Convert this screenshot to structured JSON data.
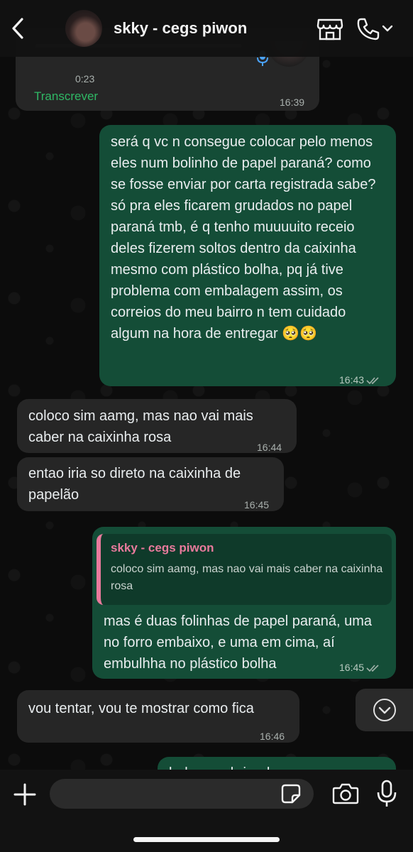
{
  "header": {
    "contact_name": "skky - cegs piwon"
  },
  "voice_message": {
    "duration": "0:23",
    "transcribe_label": "Transcrever",
    "time": "16:39"
  },
  "messages": [
    {
      "direction": "out",
      "text": "será q vc n consegue colocar pelo menos eles num bolinho de papel paraná? como se fosse enviar por carta registrada sabe? só pra eles ficarem grudados no papel paraná tmb, é q tenho muuuuito receio deles fizerem soltos dentro da caixinha mesmo com plástico bolha, pq já tive problema com embalagem assim, os correios do meu bairro n tem cuidado algum na hora de entregar 🥺🥺",
      "time": "16:43"
    },
    {
      "direction": "in",
      "text": "coloco sim aamg, mas nao vai mais caber na caixinha rosa",
      "time": "16:44"
    },
    {
      "direction": "in",
      "text": "entao iria so direto na caixinha de papelão",
      "time": "16:45"
    },
    {
      "direction": "out",
      "quote": {
        "author": "skky - cegs piwon",
        "text": "coloco sim aamg, mas nao vai mais caber na caixinha rosa"
      },
      "text": "mas é duas folinhas de papel paraná, uma no forro embaixo, e uma em cima, aí embulhha no plástico bolha",
      "time": "16:45"
    },
    {
      "direction": "in",
      "text": "vou tentar, vou te mostrar como fica",
      "time": "16:46"
    },
    {
      "direction": "out",
      "text": "belezaaa brigada amg",
      "time": ""
    }
  ],
  "colors": {
    "incoming_bubble": "#262626",
    "outgoing_bubble": "#144d37",
    "accent_green": "#2fb865",
    "quote_author": "#e87a9c"
  },
  "icons": {
    "back": "chevron-left-icon",
    "store": "store-icon",
    "call": "phone-icon",
    "add": "plus-icon",
    "sticker": "sticker-icon",
    "camera": "camera-icon",
    "mic": "microphone-icon",
    "scroll": "chevron-down-icon"
  }
}
